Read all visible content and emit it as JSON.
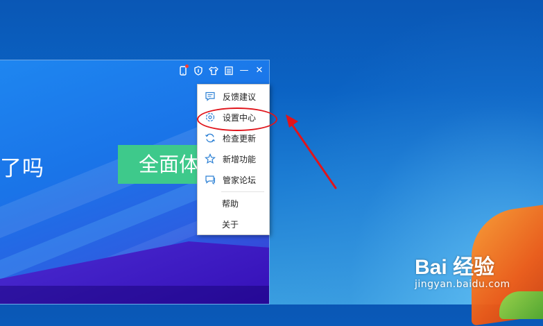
{
  "app": {
    "headline": "了吗",
    "cta_label": "全面体检"
  },
  "titlebar": {
    "icons": [
      "phone-icon",
      "shield-icon",
      "skin-icon",
      "menu-icon",
      "minimize-icon",
      "close-icon"
    ],
    "minimize_glyph": "—",
    "close_glyph": "✕"
  },
  "menu": {
    "items": [
      {
        "label": "反馈建议",
        "icon": "feedback-icon"
      },
      {
        "label": "设置中心",
        "icon": "settings-icon"
      },
      {
        "label": "检查更新",
        "icon": "refresh-icon"
      },
      {
        "label": "新增功能",
        "icon": "star-icon"
      },
      {
        "label": "管家论坛",
        "icon": "forum-icon"
      },
      {
        "label": "帮助",
        "icon": ""
      },
      {
        "label": "关于",
        "icon": ""
      }
    ]
  },
  "annotation": {
    "color": "#e0141b"
  },
  "watermark": {
    "brand": "Bai  经验",
    "url": "jingyan.baidu.com"
  },
  "colors": {
    "accent_green": "#3ec98b",
    "icon_blue": "#2a7fd4"
  }
}
